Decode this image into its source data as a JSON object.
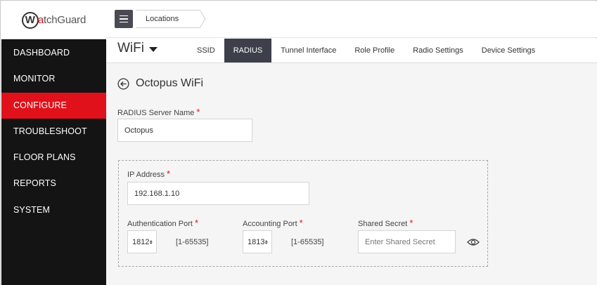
{
  "brand": {
    "logo_initial": "W",
    "logo_accent": "a",
    "logo_rest": "tchGuard",
    "accent_color": "#e0111b"
  },
  "sidebar": {
    "items": [
      {
        "label": "DASHBOARD",
        "active": false
      },
      {
        "label": "MONITOR",
        "active": false
      },
      {
        "label": "CONFIGURE",
        "active": true
      },
      {
        "label": "TROUBLESHOOT",
        "active": false
      },
      {
        "label": "FLOOR PLANS",
        "active": false
      },
      {
        "label": "REPORTS",
        "active": false
      },
      {
        "label": "SYSTEM",
        "active": false
      }
    ]
  },
  "topbar": {
    "menu_icon": "hamburger-icon",
    "breadcrumb": "Locations"
  },
  "tabbar": {
    "section_title": "WiFi",
    "tabs": [
      {
        "label": "SSID",
        "active": false
      },
      {
        "label": "RADIUS",
        "active": true
      },
      {
        "label": "Tunnel Interface",
        "active": false
      },
      {
        "label": "Role Profile",
        "active": false
      },
      {
        "label": "Radio Settings",
        "active": false
      },
      {
        "label": "Device Settings",
        "active": false
      }
    ]
  },
  "page": {
    "title": "Octopus WiFi",
    "back_icon": "back-arrow-circle-icon"
  },
  "form": {
    "required_mark": "*",
    "server_name_label": "RADIUS Server Name",
    "server_name_value": "Octopus",
    "ip_label": "IP Address",
    "ip_value": "192.168.1.10",
    "auth_port_label": "Authentication Port",
    "auth_port_value": "1812",
    "auth_port_range": "[1-65535]",
    "acct_port_label": "Accounting Port",
    "acct_port_value": "1813",
    "acct_port_range": "[1-65535]",
    "secret_label": "Shared Secret",
    "secret_value": "",
    "secret_placeholder": "Enter Shared Secret",
    "secret_icon": "eye-icon"
  }
}
